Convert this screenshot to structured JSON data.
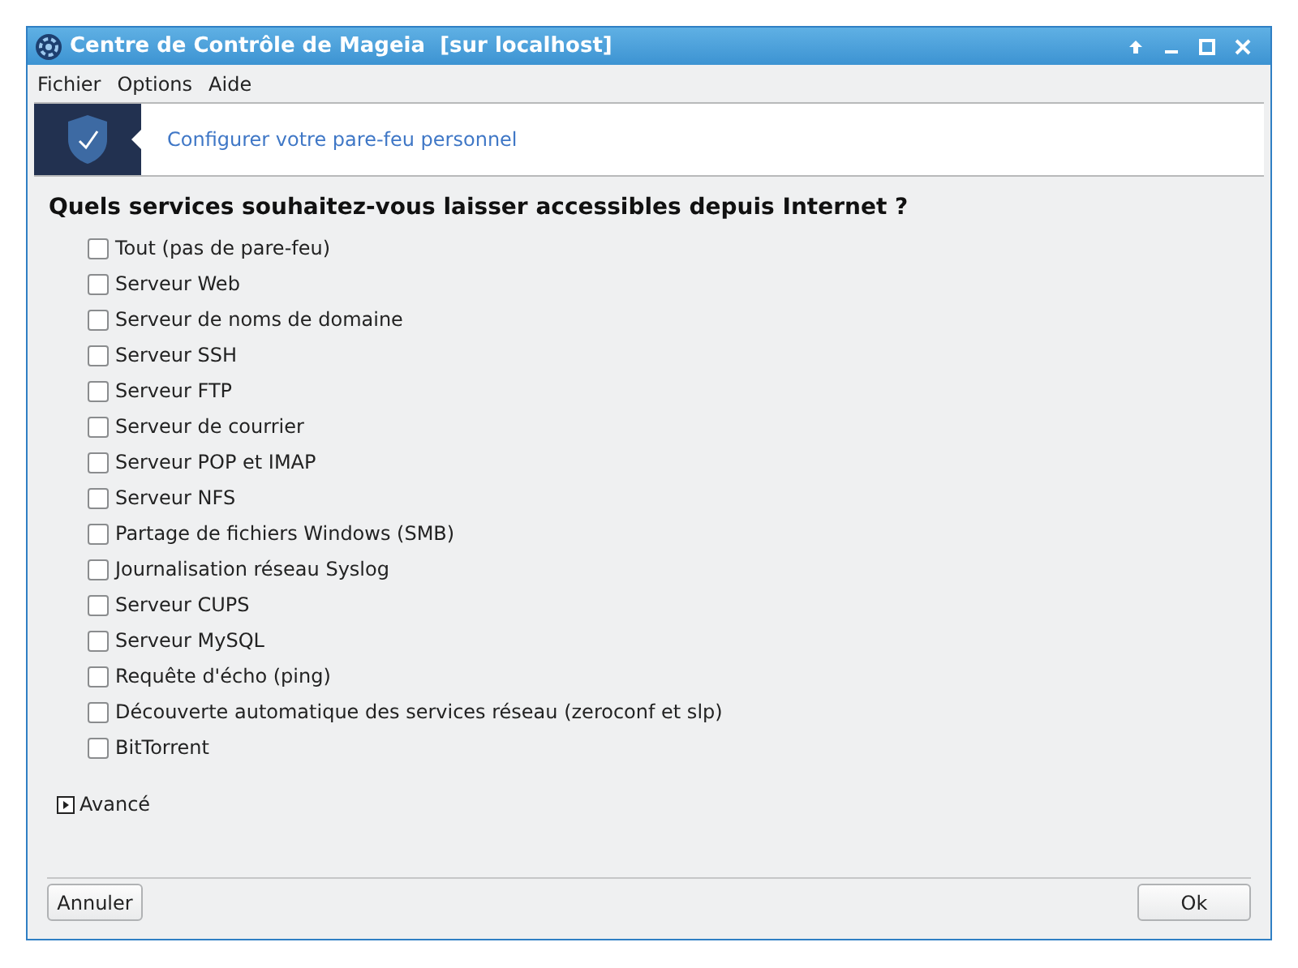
{
  "window": {
    "title": "Centre de Contrôle de Mageia  [sur localhost]"
  },
  "menu": [
    "Fichier",
    "Options",
    "Aide"
  ],
  "banner": {
    "title": "Configurer votre pare-feu personnel"
  },
  "heading": "Quels services souhaitez-vous laisser accessibles depuis Internet ?",
  "services": [
    {
      "label": "Tout (pas de pare-feu)",
      "checked": false
    },
    {
      "label": "Serveur Web",
      "checked": false
    },
    {
      "label": "Serveur de noms de domaine",
      "checked": false
    },
    {
      "label": "Serveur SSH",
      "checked": false
    },
    {
      "label": "Serveur FTP",
      "checked": false
    },
    {
      "label": "Serveur de courrier",
      "checked": false
    },
    {
      "label": "Serveur POP et IMAP",
      "checked": false
    },
    {
      "label": "Serveur NFS",
      "checked": false
    },
    {
      "label": "Partage de fichiers Windows (SMB)",
      "checked": false
    },
    {
      "label": "Journalisation réseau Syslog",
      "checked": false
    },
    {
      "label": "Serveur CUPS",
      "checked": false
    },
    {
      "label": "Serveur MySQL",
      "checked": false
    },
    {
      "label": "Requête d'écho (ping)",
      "checked": false
    },
    {
      "label": "Découverte automatique des services réseau (zeroconf et slp)",
      "checked": false
    },
    {
      "label": "BitTorrent",
      "checked": false
    }
  ],
  "advanced": {
    "label": "Avancé",
    "expanded": false
  },
  "buttons": [
    "Annuler",
    "Ok"
  ]
}
